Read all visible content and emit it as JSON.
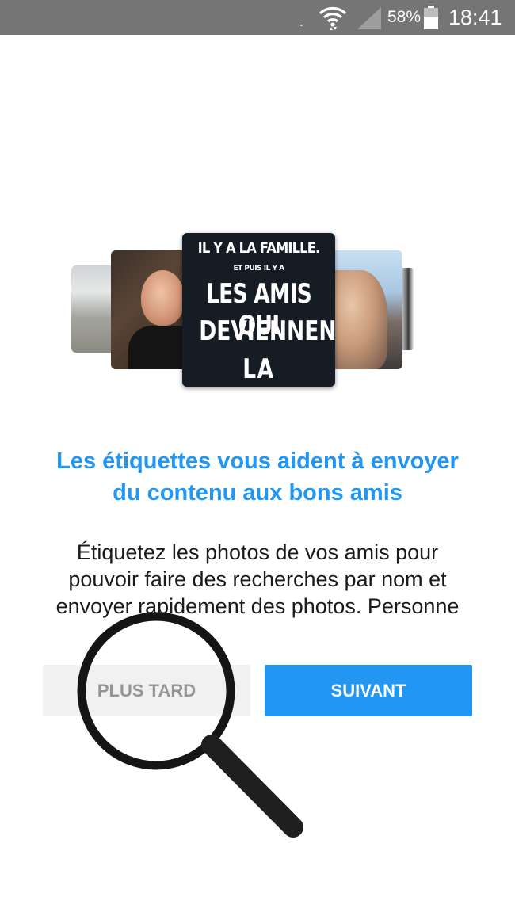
{
  "status_bar": {
    "battery_percent": "58%",
    "time": "18:41",
    "icons": [
      "wifi-icon",
      "signal-icon",
      "battery-icon"
    ]
  },
  "carousel": {
    "featured_photo_text": {
      "line1": "IL Y A LA FAMILLE.",
      "line2": "ET PUIS IL Y A",
      "line3": "LES AMIS QUI",
      "line4": "DEVIENNENT",
      "line5": "LA FAMILLE"
    }
  },
  "headline": {
    "line1": "Les étiquettes vous aident à envoyer",
    "line2": "du contenu aux bons amis"
  },
  "body": {
    "line1": "Étiquetez les photos de vos amis pour",
    "line2": "pouvoir faire des recherches par nom et",
    "line3": "envoyer rapidement des photos. Personne"
  },
  "buttons": {
    "later_label": "PLUS TARD",
    "next_label": "SUIVANT"
  },
  "colors": {
    "status_bar": "#757575",
    "accent": "#2196f3",
    "secondary_button": "#f1f1f1",
    "secondary_button_text": "#8f8f8f"
  }
}
